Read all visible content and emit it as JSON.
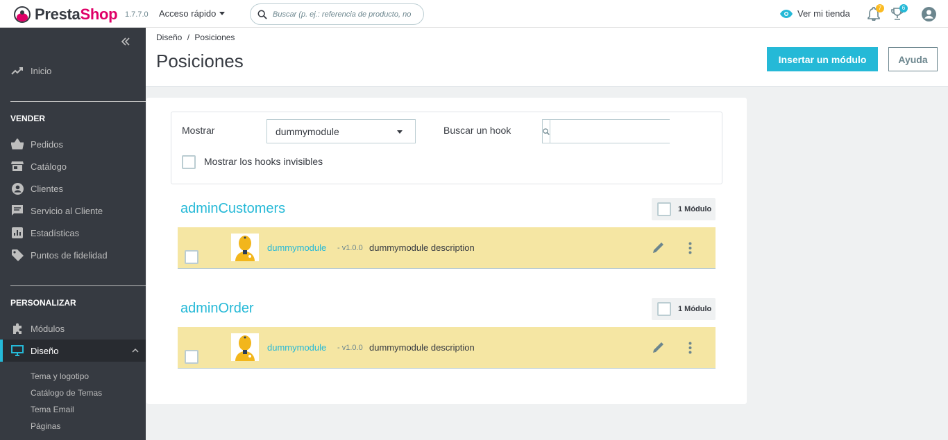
{
  "header": {
    "logo_prefix": "Presta",
    "logo_suffix": "Shop",
    "version": "1.7.7.0",
    "quick_access": "Acceso rápido",
    "search_placeholder": "Buscar (p. ej.: referencia de producto, no",
    "view_shop": "Ver mi tienda",
    "notifications_count": "7",
    "trophy_count": "6",
    "accent": "#25b9d7",
    "badge_color": "#fbbb22"
  },
  "sidebar": {
    "home": "Inicio",
    "section_sell": "VENDER",
    "sell_items": [
      "Pedidos",
      "Catálogo",
      "Clientes",
      "Servicio al Cliente",
      "Estadísticas",
      "Puntos de fidelidad"
    ],
    "section_customize": "PERSONALIZAR",
    "modules": "Módulos",
    "design": "Diseño",
    "design_sub": [
      "Tema y logotipo",
      "Catálogo de Temas",
      "Tema Email",
      "Páginas"
    ]
  },
  "page": {
    "breadcrumb_parent": "Diseño",
    "breadcrumb_sep": "/",
    "breadcrumb_current": "Posiciones",
    "title": "Posiciones",
    "insert_button": "Insertar un módulo",
    "help_button": "Ayuda"
  },
  "filters": {
    "show_label": "Mostrar",
    "show_value": "dummymodule",
    "search_hook_label": "Buscar un hook",
    "search_hook_value": "",
    "invisible_hooks_label": "Mostrar los hooks invisibles"
  },
  "hooks": [
    {
      "name": "adminCustomers",
      "count_label": "1 Módulo",
      "module": {
        "name": "dummymodule",
        "version": "- v1.0.0",
        "description": "dummymodule description"
      }
    },
    {
      "name": "adminOrder",
      "count_label": "1 Módulo",
      "module": {
        "name": "dummymodule",
        "version": "- v1.0.0",
        "description": "dummymodule description"
      }
    }
  ]
}
